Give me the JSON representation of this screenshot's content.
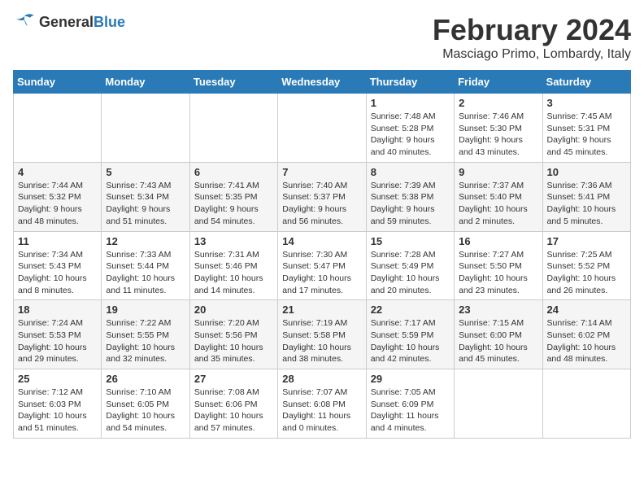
{
  "header": {
    "logo_general": "General",
    "logo_blue": "Blue",
    "month_year": "February 2024",
    "location": "Masciago Primo, Lombardy, Italy"
  },
  "columns": [
    "Sunday",
    "Monday",
    "Tuesday",
    "Wednesday",
    "Thursday",
    "Friday",
    "Saturday"
  ],
  "weeks": [
    [
      {
        "day": "",
        "info": ""
      },
      {
        "day": "",
        "info": ""
      },
      {
        "day": "",
        "info": ""
      },
      {
        "day": "",
        "info": ""
      },
      {
        "day": "1",
        "info": "Sunrise: 7:48 AM\nSunset: 5:28 PM\nDaylight: 9 hours\nand 40 minutes."
      },
      {
        "day": "2",
        "info": "Sunrise: 7:46 AM\nSunset: 5:30 PM\nDaylight: 9 hours\nand 43 minutes."
      },
      {
        "day": "3",
        "info": "Sunrise: 7:45 AM\nSunset: 5:31 PM\nDaylight: 9 hours\nand 45 minutes."
      }
    ],
    [
      {
        "day": "4",
        "info": "Sunrise: 7:44 AM\nSunset: 5:32 PM\nDaylight: 9 hours\nand 48 minutes."
      },
      {
        "day": "5",
        "info": "Sunrise: 7:43 AM\nSunset: 5:34 PM\nDaylight: 9 hours\nand 51 minutes."
      },
      {
        "day": "6",
        "info": "Sunrise: 7:41 AM\nSunset: 5:35 PM\nDaylight: 9 hours\nand 54 minutes."
      },
      {
        "day": "7",
        "info": "Sunrise: 7:40 AM\nSunset: 5:37 PM\nDaylight: 9 hours\nand 56 minutes."
      },
      {
        "day": "8",
        "info": "Sunrise: 7:39 AM\nSunset: 5:38 PM\nDaylight: 9 hours\nand 59 minutes."
      },
      {
        "day": "9",
        "info": "Sunrise: 7:37 AM\nSunset: 5:40 PM\nDaylight: 10 hours\nand 2 minutes."
      },
      {
        "day": "10",
        "info": "Sunrise: 7:36 AM\nSunset: 5:41 PM\nDaylight: 10 hours\nand 5 minutes."
      }
    ],
    [
      {
        "day": "11",
        "info": "Sunrise: 7:34 AM\nSunset: 5:43 PM\nDaylight: 10 hours\nand 8 minutes."
      },
      {
        "day": "12",
        "info": "Sunrise: 7:33 AM\nSunset: 5:44 PM\nDaylight: 10 hours\nand 11 minutes."
      },
      {
        "day": "13",
        "info": "Sunrise: 7:31 AM\nSunset: 5:46 PM\nDaylight: 10 hours\nand 14 minutes."
      },
      {
        "day": "14",
        "info": "Sunrise: 7:30 AM\nSunset: 5:47 PM\nDaylight: 10 hours\nand 17 minutes."
      },
      {
        "day": "15",
        "info": "Sunrise: 7:28 AM\nSunset: 5:49 PM\nDaylight: 10 hours\nand 20 minutes."
      },
      {
        "day": "16",
        "info": "Sunrise: 7:27 AM\nSunset: 5:50 PM\nDaylight: 10 hours\nand 23 minutes."
      },
      {
        "day": "17",
        "info": "Sunrise: 7:25 AM\nSunset: 5:52 PM\nDaylight: 10 hours\nand 26 minutes."
      }
    ],
    [
      {
        "day": "18",
        "info": "Sunrise: 7:24 AM\nSunset: 5:53 PM\nDaylight: 10 hours\nand 29 minutes."
      },
      {
        "day": "19",
        "info": "Sunrise: 7:22 AM\nSunset: 5:55 PM\nDaylight: 10 hours\nand 32 minutes."
      },
      {
        "day": "20",
        "info": "Sunrise: 7:20 AM\nSunset: 5:56 PM\nDaylight: 10 hours\nand 35 minutes."
      },
      {
        "day": "21",
        "info": "Sunrise: 7:19 AM\nSunset: 5:58 PM\nDaylight: 10 hours\nand 38 minutes."
      },
      {
        "day": "22",
        "info": "Sunrise: 7:17 AM\nSunset: 5:59 PM\nDaylight: 10 hours\nand 42 minutes."
      },
      {
        "day": "23",
        "info": "Sunrise: 7:15 AM\nSunset: 6:00 PM\nDaylight: 10 hours\nand 45 minutes."
      },
      {
        "day": "24",
        "info": "Sunrise: 7:14 AM\nSunset: 6:02 PM\nDaylight: 10 hours\nand 48 minutes."
      }
    ],
    [
      {
        "day": "25",
        "info": "Sunrise: 7:12 AM\nSunset: 6:03 PM\nDaylight: 10 hours\nand 51 minutes."
      },
      {
        "day": "26",
        "info": "Sunrise: 7:10 AM\nSunset: 6:05 PM\nDaylight: 10 hours\nand 54 minutes."
      },
      {
        "day": "27",
        "info": "Sunrise: 7:08 AM\nSunset: 6:06 PM\nDaylight: 10 hours\nand 57 minutes."
      },
      {
        "day": "28",
        "info": "Sunrise: 7:07 AM\nSunset: 6:08 PM\nDaylight: 11 hours\nand 0 minutes."
      },
      {
        "day": "29",
        "info": "Sunrise: 7:05 AM\nSunset: 6:09 PM\nDaylight: 11 hours\nand 4 minutes."
      },
      {
        "day": "",
        "info": ""
      },
      {
        "day": "",
        "info": ""
      }
    ]
  ]
}
